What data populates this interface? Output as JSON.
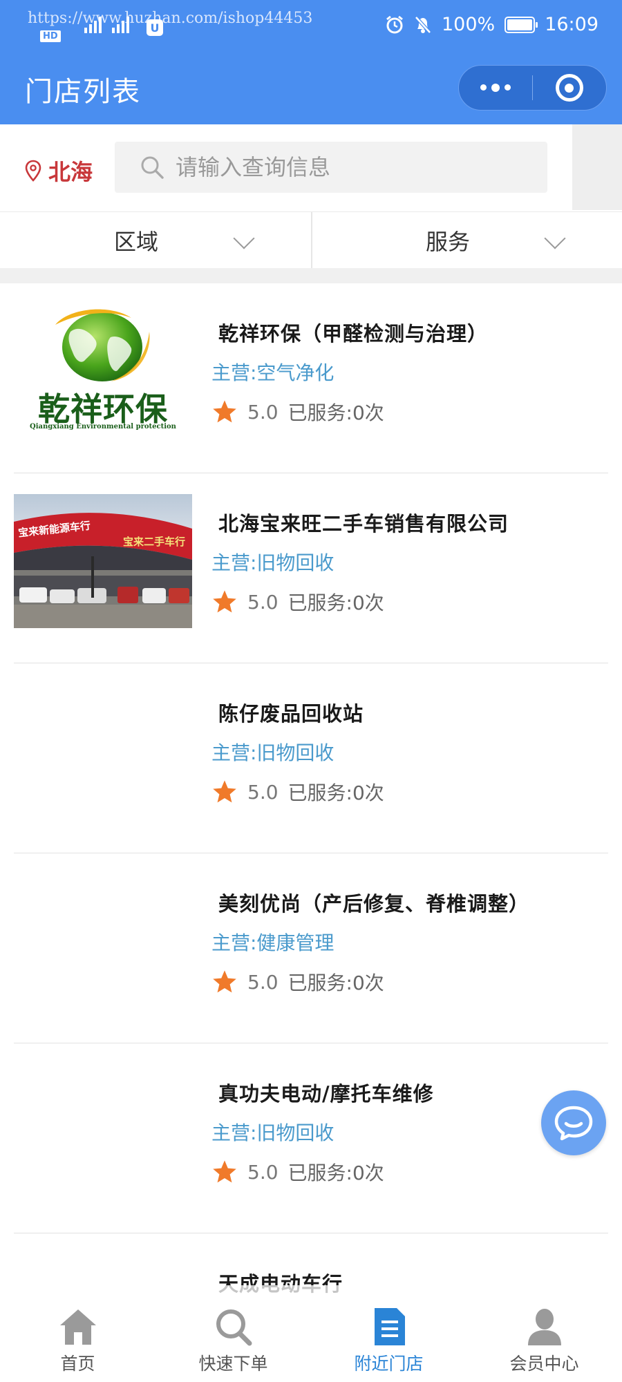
{
  "status_bar": {
    "watermark": "https://www.huzhan.com/ishop44453",
    "hd_label": "HD",
    "u_label": "U",
    "battery": "100%",
    "time": "16:09"
  },
  "header": {
    "title": "门店列表",
    "background_color": "#4a8ef0"
  },
  "search": {
    "city": "北海",
    "placeholder": "请输入查询信息",
    "value": ""
  },
  "filters": [
    {
      "label": "区域"
    },
    {
      "label": "服务"
    }
  ],
  "stores": [
    {
      "name": "乾祥环保（甲醛检测与治理）",
      "main": "主营:空气净化",
      "rating": "5.0",
      "served": "已服务:0次",
      "logo_text": "乾祥环保",
      "logo_subtext": "Qiangxiang Environmental protection"
    },
    {
      "name": "北海宝来旺二手车销售有限公司",
      "main": "主营:旧物回收",
      "rating": "5.0",
      "served": "已服务:0次",
      "photo_sign_left": "宝来新能源车行",
      "photo_sign_right": "宝来二手车行"
    },
    {
      "name": "陈仔废品回收站",
      "main": "主营:旧物回收",
      "rating": "5.0",
      "served": "已服务:0次"
    },
    {
      "name": "美刻优尚（产后修复、脊椎调整）",
      "main": "主营:健康管理",
      "rating": "5.0",
      "served": "已服务:0次"
    },
    {
      "name": "真功夫电动/摩托车维修",
      "main": "主营:旧物回收",
      "rating": "5.0",
      "served": "已服务:0次"
    },
    {
      "name": "天成电动车行"
    }
  ],
  "tabbar": [
    {
      "label": "首页",
      "icon": "home-icon"
    },
    {
      "label": "快速下单",
      "icon": "search-icon"
    },
    {
      "label": "附近门店",
      "icon": "document-icon",
      "active": true
    },
    {
      "label": "会员中心",
      "icon": "user-icon"
    }
  ],
  "colors": {
    "accent": "#4a8ef0",
    "tab_active": "#2a84d6",
    "main_text": "#4a9acc",
    "star": "#f07a2a",
    "city": "#c8373a"
  }
}
